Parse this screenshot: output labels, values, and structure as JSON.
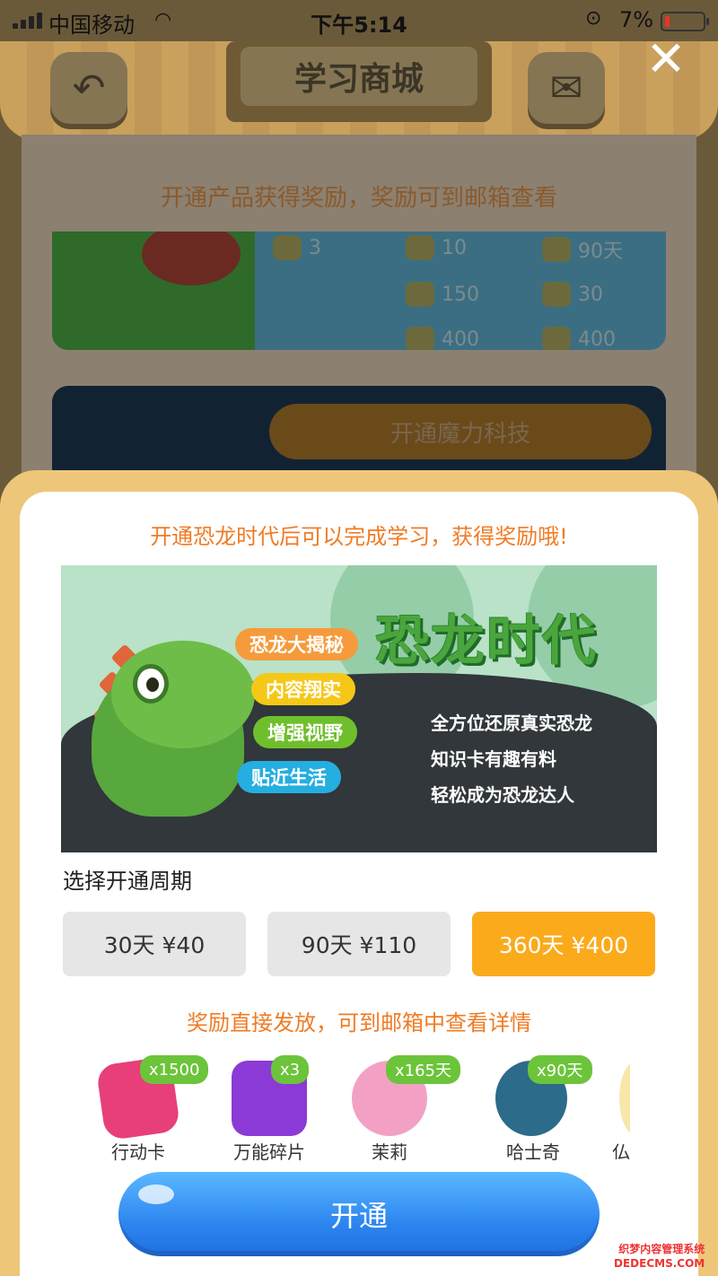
{
  "status_bar": {
    "carrier": "中国移动",
    "time": "下午5:14",
    "battery_percent": "7%",
    "battery_level": 0.07
  },
  "background_page": {
    "title": "学习商城",
    "notice": "开通产品获得奖励，奖励可到邮箱查看",
    "rewards": [
      "3",
      "10",
      "90天",
      "150",
      "30",
      "400",
      "400"
    ],
    "open_button": "开通魔力科技"
  },
  "modal": {
    "tip": "开通恐龙时代后可以完成学习，获得奖励哦!",
    "banner": {
      "title": "恐龙时代",
      "tags": [
        "恐龙大揭秘",
        "内容翔实",
        "增强视野",
        "贴近生活"
      ],
      "lines": [
        "全方位还原真实恐龙",
        "知识卡有趣有料",
        "轻松成为恐龙达人"
      ]
    },
    "period_label": "选择开通周期",
    "periods": [
      {
        "label": "30天 ¥40",
        "selected": false
      },
      {
        "label": "90天 ¥110",
        "selected": false
      },
      {
        "label": "360天 ¥400",
        "selected": true
      }
    ],
    "reward_tip": "奖励直接发放，可到邮箱中查看详情",
    "rewards": [
      {
        "name": "行动卡",
        "count": "x1500"
      },
      {
        "name": "万能碎片",
        "count": "x3"
      },
      {
        "name": "茉莉",
        "count": "x165天"
      },
      {
        "name": "哈士奇",
        "count": "x90天"
      },
      {
        "name": "仏",
        "count": ""
      }
    ],
    "open_button": "开通"
  },
  "watermark": [
    "织梦内容管理系统",
    "DEDECMS.COM"
  ],
  "colors": {
    "accent_orange": "#fbaa1b",
    "tip_orange": "#f07b24",
    "button_blue": "#2e86f0",
    "modal_frame": "#eec67a",
    "badge_green": "#6cc43a"
  }
}
